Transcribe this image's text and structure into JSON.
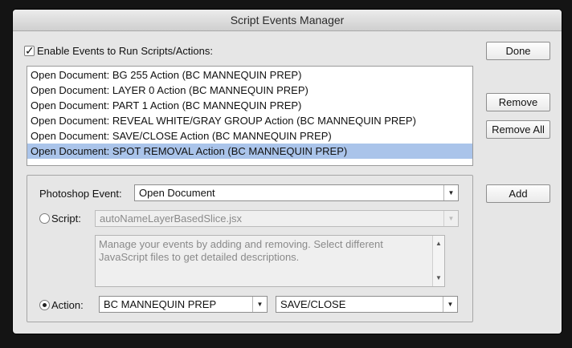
{
  "window": {
    "title": "Script Events Manager"
  },
  "enable_events": {
    "label": "Enable Events to Run Scripts/Actions:",
    "checked": true
  },
  "events_list": {
    "items": [
      "Open Document: BG 255 Action (BC MANNEQUIN PREP)",
      "Open Document: LAYER 0 Action (BC MANNEQUIN PREP)",
      "Open Document: PART 1 Action (BC MANNEQUIN PREP)",
      "Open Document: REVEAL WHITE/GRAY GROUP Action (BC MANNEQUIN PREP)",
      "Open Document: SAVE/CLOSE Action (BC MANNEQUIN PREP)",
      "Open Document: SPOT REMOVAL Action (BC MANNEQUIN PREP)"
    ],
    "selected_index": 5
  },
  "buttons": {
    "done": "Done",
    "remove": "Remove",
    "remove_all": "Remove All",
    "add": "Add"
  },
  "photoshop_event": {
    "label": "Photoshop Event:",
    "value": "Open Document"
  },
  "script": {
    "label": "Script:",
    "value": "autoNameLayerBasedSlice.jsx",
    "description": "Manage your events by adding and removing. Select different JavaScript files to get detailed descriptions.",
    "selected": false
  },
  "action": {
    "label": "Action:",
    "set_value": "BC MANNEQUIN PREP",
    "action_value": "SAVE/CLOSE",
    "selected": true
  },
  "icons": {
    "dropdown_arrow": "▼",
    "scroll_up": "▲",
    "scroll_down": "▼",
    "checkmark": "✓"
  }
}
